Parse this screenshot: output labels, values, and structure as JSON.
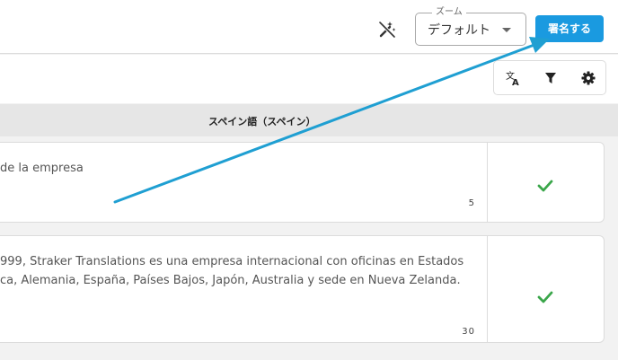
{
  "header": {
    "zoom_legend": "ズーム",
    "zoom_value": "デフォルト",
    "sign_button": "署名する"
  },
  "toolbar": {
    "icons": [
      "translate-icon",
      "filter-icon",
      "gear-icon"
    ]
  },
  "column_header": "スペイン語（スペイン）",
  "rows": [
    {
      "lines": [
        "de la empresa"
      ],
      "count": "5",
      "status": "check"
    },
    {
      "lines": [
        "999, Straker Translations es una empresa internacional con oficinas en Estados",
        "ca, Alemania, España, Países Bajos, Japón, Australia y sede en Nueva Zelanda."
      ],
      "count": "30",
      "status": "check"
    }
  ],
  "colors": {
    "accent": "#1a9ae0",
    "check": "#3aa64a",
    "arrow": "#1f9fd2"
  }
}
